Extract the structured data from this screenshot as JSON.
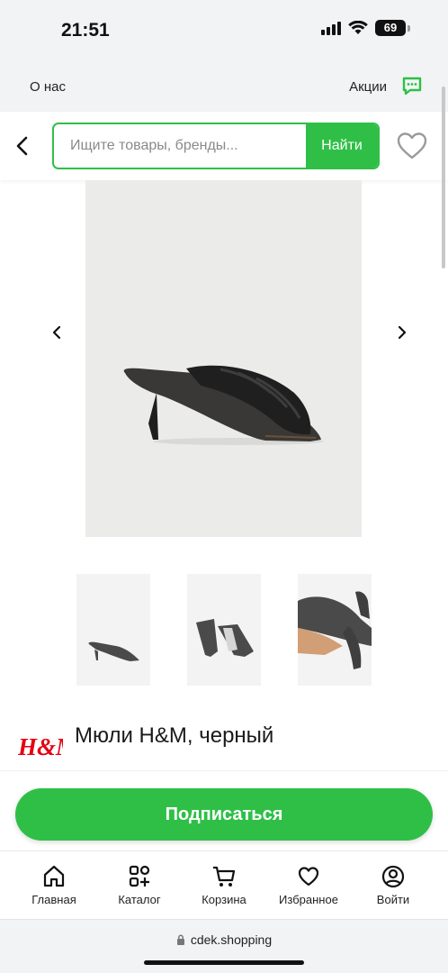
{
  "status_bar": {
    "time": "21:51",
    "battery": "69"
  },
  "top_links": {
    "about": "О нас",
    "promo": "Акции",
    "chat_icon": "chat-icon",
    "accent_color": "#2fbf47"
  },
  "search": {
    "placeholder": "Ищите товары, бренды...",
    "button_label": "Найти"
  },
  "product": {
    "title": "Мюли H&M, черный",
    "brand_logo_text": "H&M",
    "brand_color": "#e50010"
  },
  "subscribe": {
    "label": "Подписаться"
  },
  "tab_bar": {
    "items": [
      {
        "label": "Главная",
        "icon": "home-icon"
      },
      {
        "label": "Каталог",
        "icon": "catalog-icon"
      },
      {
        "label": "Корзина",
        "icon": "cart-icon"
      },
      {
        "label": "Избранное",
        "icon": "heart-icon"
      },
      {
        "label": "Войти",
        "icon": "user-icon"
      }
    ]
  },
  "browser": {
    "url": "cdek.shopping"
  }
}
